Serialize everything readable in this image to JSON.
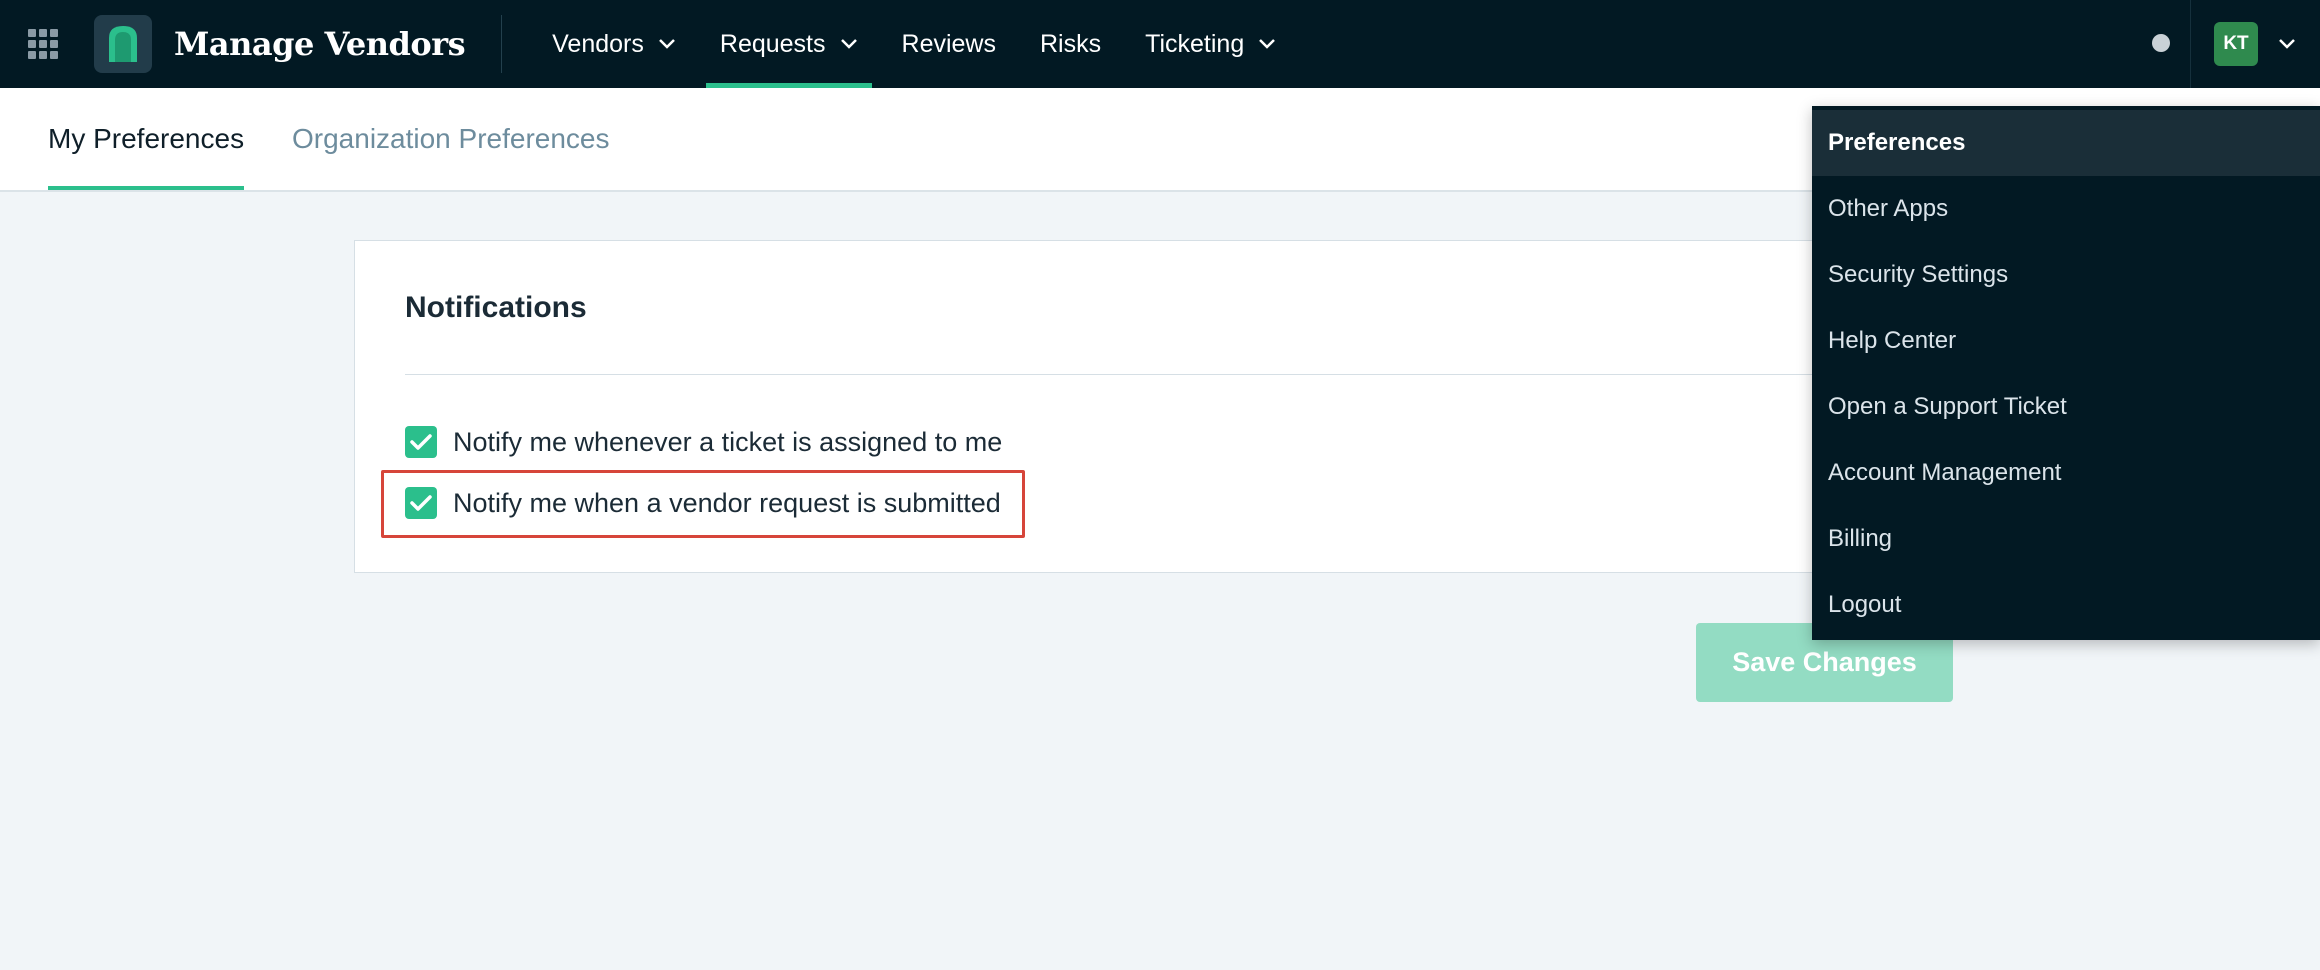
{
  "header": {
    "brand": "Manage Vendors",
    "nav": [
      {
        "label": "Vendors",
        "has_dropdown": true
      },
      {
        "label": "Requests",
        "has_dropdown": true,
        "active": true
      },
      {
        "label": "Reviews",
        "has_dropdown": false
      },
      {
        "label": "Risks",
        "has_dropdown": false
      },
      {
        "label": "Ticketing",
        "has_dropdown": true
      }
    ],
    "user_initials": "KT"
  },
  "tabs": [
    {
      "label": "My Preferences",
      "active": true
    },
    {
      "label": "Organization Preferences",
      "active": false
    }
  ],
  "notifications": {
    "title": "Notifications",
    "options": [
      {
        "label": "Notify me whenever a ticket is assigned to me",
        "checked": true
      },
      {
        "label": "Notify me when a vendor request is submitted",
        "checked": true
      }
    ]
  },
  "save_label": "Save Changes",
  "user_menu": {
    "items": [
      {
        "label": "Preferences",
        "active": true
      },
      {
        "label": "Other Apps"
      },
      {
        "label": "Security Settings"
      },
      {
        "label": "Help Center"
      },
      {
        "label": "Open a Support Ticket"
      },
      {
        "label": "Account Management"
      },
      {
        "label": "Billing"
      },
      {
        "label": "Logout"
      }
    ]
  },
  "colors": {
    "header_bg": "#021923",
    "accent": "#2bbf8c",
    "save_disabled": "#93dcc3",
    "highlight": "#d6453a"
  }
}
